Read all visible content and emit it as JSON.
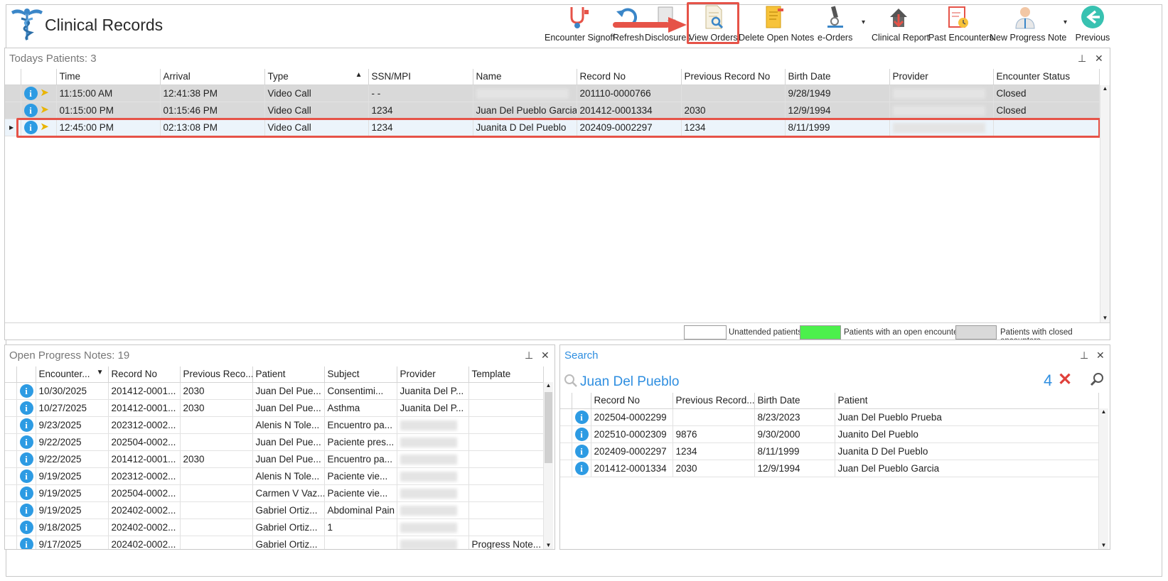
{
  "app": {
    "title": "Clinical Records"
  },
  "toolbar": {
    "buttons": [
      {
        "label": "Encounter Signoff",
        "icon": "stethoscope-icon"
      },
      {
        "label": "Refresh",
        "icon": "refresh-icon"
      },
      {
        "label": "Disclosures",
        "icon": "disclosures-icon"
      },
      {
        "label": "View Orders",
        "icon": "view-orders-icon"
      },
      {
        "label": "Delete Open Notes",
        "icon": "delete-notes-icon"
      },
      {
        "label": "e-Orders",
        "icon": "microscope-icon"
      },
      {
        "label": "Clinical Report",
        "icon": "clinical-report-icon"
      },
      {
        "label": "Past Encounters",
        "icon": "past-encounters-icon"
      },
      {
        "label": "New Progress Note",
        "icon": "doctor-icon"
      },
      {
        "label": "Previous",
        "icon": "arrow-left-icon"
      }
    ]
  },
  "todays": {
    "title": "Todays Patients:",
    "count": "3",
    "columns": [
      "Time",
      "Arrival",
      "Type",
      "SSN/MPI",
      "Name",
      "Record No",
      "Previous Record No",
      "Birth Date",
      "Provider",
      "Encounter Status"
    ],
    "rows": [
      {
        "time": "11:15:00 AM",
        "arrival": "12:41:38 PM",
        "type": "Video Call",
        "ssn": "-  -",
        "name": "",
        "record": "201110-0000766",
        "prev": "",
        "birth": "9/28/1949",
        "provider": "",
        "status": "Closed"
      },
      {
        "time": "01:15:00 PM",
        "arrival": "01:15:46 PM",
        "type": "Video Call",
        "ssn": "1234",
        "name": "Juan Del Pueblo Garcia",
        "record": "201412-0001334",
        "prev": "2030",
        "birth": "12/9/1994",
        "provider": "",
        "status": "Closed"
      },
      {
        "time": "12:45:00 PM",
        "arrival": "02:13:08 PM",
        "type": "Video Call",
        "ssn": "1234",
        "name": "Juanita D Del Pueblo",
        "record": "202409-0002297",
        "prev": "1234",
        "birth": "8/11/1999",
        "provider": "",
        "status": ""
      }
    ],
    "legend": {
      "unattended": "Unattended patients",
      "open": "Patients with an open encounter",
      "closed": "Patients with closed encounters"
    },
    "colors": {
      "open": "#4cf04c",
      "closed": "#d9d9d9",
      "unattended": "#ffffff",
      "highlight": "#e65348"
    }
  },
  "notes": {
    "title": "Open Progress Notes:",
    "count": "19",
    "columns": [
      "Encounter...",
      "Record No",
      "Previous Reco...",
      "Patient",
      "Subject",
      "Provider",
      "Template"
    ],
    "rows": [
      {
        "date": "10/30/2025",
        "record": "201412-0001...",
        "prev": "2030",
        "patient": "Juan Del Pue...",
        "subject": "Consentimi...",
        "provider": "Juanita Del P...",
        "template": ""
      },
      {
        "date": "10/27/2025",
        "record": "201412-0001...",
        "prev": "2030",
        "patient": "Juan Del Pue...",
        "subject": "Asthma",
        "provider": "Juanita Del P...",
        "template": ""
      },
      {
        "date": "9/23/2025",
        "record": "202312-0002...",
        "prev": "",
        "patient": "Alenis N Tole...",
        "subject": "Encuentro pa...",
        "provider": "",
        "template": ""
      },
      {
        "date": "9/22/2025",
        "record": "202504-0002...",
        "prev": "",
        "patient": "Juan Del Pue...",
        "subject": "Paciente pres...",
        "provider": "",
        "template": ""
      },
      {
        "date": "9/22/2025",
        "record": "201412-0001...",
        "prev": "2030",
        "patient": "Juan Del Pue...",
        "subject": "Encuentro pa...",
        "provider": "",
        "template": ""
      },
      {
        "date": "9/19/2025",
        "record": "202312-0002...",
        "prev": "",
        "patient": "Alenis N Tole...",
        "subject": "Paciente vie...",
        "provider": "",
        "template": ""
      },
      {
        "date": "9/19/2025",
        "record": "202504-0002...",
        "prev": "",
        "patient": "Carmen V Vaz...",
        "subject": "Paciente vie...",
        "provider": "",
        "template": ""
      },
      {
        "date": "9/19/2025",
        "record": "202402-0002...",
        "prev": "",
        "patient": "Gabriel Ortiz...",
        "subject": "Abdominal Pain",
        "provider": "",
        "template": ""
      },
      {
        "date": "9/18/2025",
        "record": "202402-0002...",
        "prev": "",
        "patient": "Gabriel Ortiz...",
        "subject": "1",
        "provider": "",
        "template": ""
      },
      {
        "date": "9/17/2025",
        "record": "202402-0002...",
        "prev": "",
        "patient": "Gabriel Ortiz...",
        "subject": "",
        "provider": "",
        "template": "Progress Note..."
      }
    ]
  },
  "search": {
    "title": "Search",
    "query": "Juan Del Pueblo",
    "count": "4",
    "columns": [
      "Record No",
      "Previous Record...",
      "Birth Date",
      "Patient"
    ],
    "rows": [
      {
        "record": "202504-0002299",
        "prev": "",
        "birth": "8/23/2023",
        "patient": "Juan Del Pueblo Prueba"
      },
      {
        "record": "202510-0002309",
        "prev": "9876",
        "birth": "9/30/2000",
        "patient": "Juanito Del Pueblo"
      },
      {
        "record": "202409-0002297",
        "prev": "1234",
        "birth": "8/11/1999",
        "patient": "Juanita D Del Pueblo"
      },
      {
        "record": "201412-0001334",
        "prev": "2030",
        "birth": "12/9/1994",
        "patient": "Juan Del Pueblo Garcia"
      }
    ]
  }
}
